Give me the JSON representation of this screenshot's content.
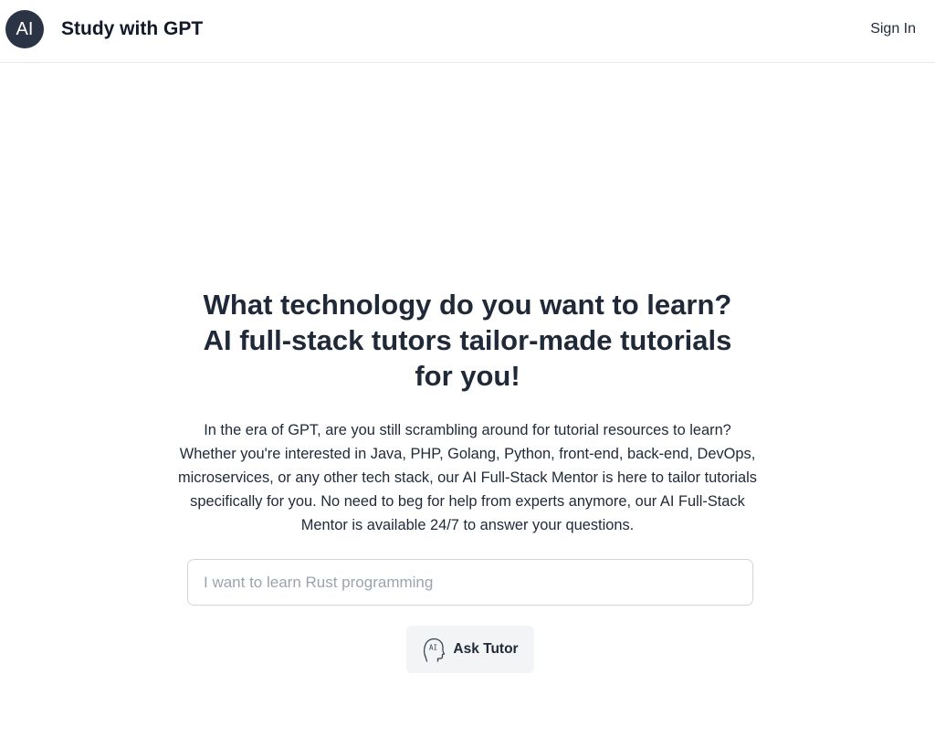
{
  "header": {
    "logo_text": "AI",
    "brand": "Study with GPT",
    "sign_in": "Sign In"
  },
  "hero": {
    "title_lines": [
      "What technology do you want to learn?",
      "AI full-stack tutors tailor-made tutorials",
      "for you!"
    ],
    "description": "In the era of GPT, are you still scrambling around for tutorial resources to learn? Whether you're interested in Java, PHP, Golang, Python, front-end, back-end, DevOps, microservices, or any other tech stack, our AI Full-Stack Mentor is here to tailor tutorials specifically for you. No need to beg for help from experts anymore, our AI Full-Stack Mentor is available 24/7 to answer your questions."
  },
  "search": {
    "value": "",
    "placeholder": "I want to learn Rust programming"
  },
  "ask_button": {
    "label": "Ask Tutor",
    "icon": "ai-head-icon",
    "icon_text": "AI"
  },
  "colors": {
    "logo_bg": "#2b3444",
    "text": "#1f2937",
    "button_bg": "#f3f4f6",
    "border": "#d1d5db",
    "placeholder": "#9ca3af"
  }
}
